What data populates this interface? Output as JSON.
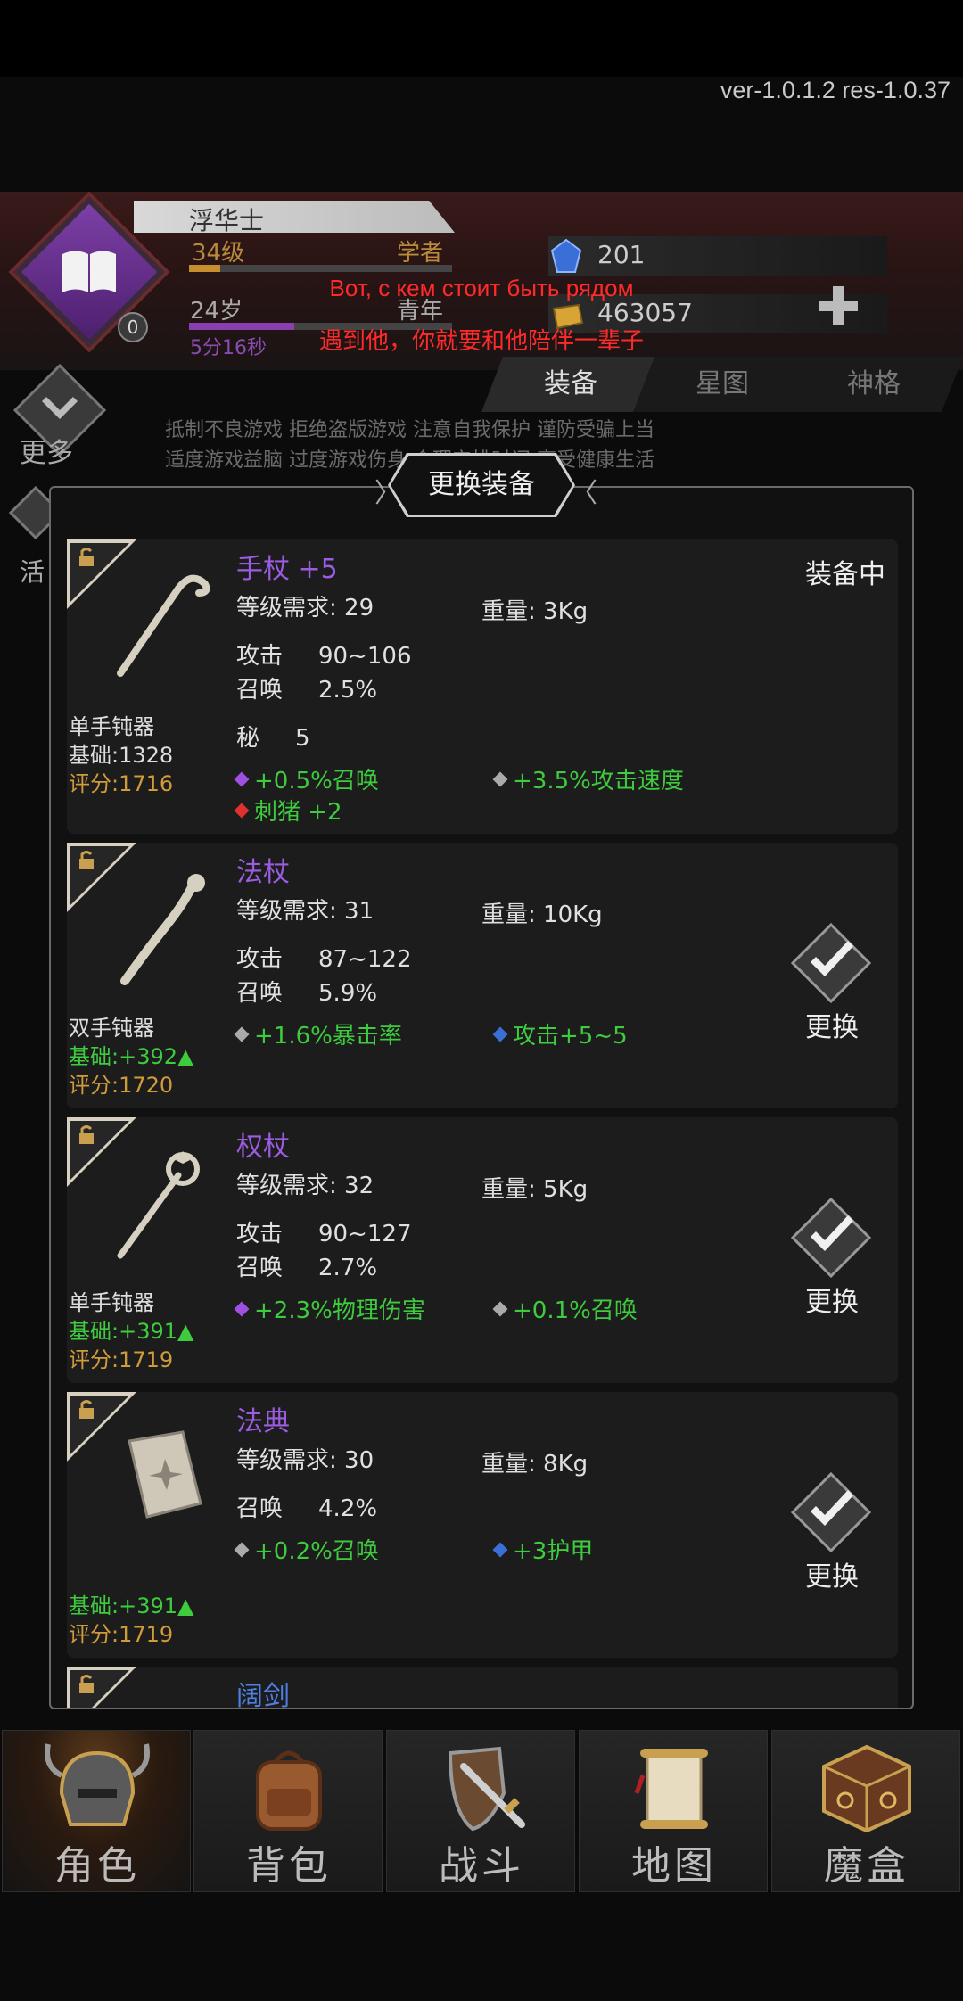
{
  "version": "ver-1.0.1.2  res-1.0.37",
  "player": {
    "name": "浮华士",
    "level": "34级",
    "class": "学者",
    "age": "24岁",
    "stage": "青年",
    "time": "5分16秒",
    "badge": "0"
  },
  "resources": {
    "gems": "201",
    "gold": "463057"
  },
  "subtitles": {
    "line1": "Вот, с кем стоит быть рядом",
    "line2": "遇到他，你就要和他陪伴一辈子"
  },
  "tabs": [
    "装备",
    "星图",
    "神格"
  ],
  "left_menu": {
    "more": "更多",
    "activity": "活"
  },
  "notice": {
    "line1": "抵制不良游戏 拒绝盗版游戏 注意自我保护 谨防受骗上当",
    "line2": "适度游戏益脑 过度游戏伤身 合理安排时间 享受健康生活"
  },
  "dialog": {
    "title": "更换装备",
    "labels": {
      "req": "等级需求:",
      "weight": "重量:",
      "attack": "攻击",
      "summon": "召唤",
      "secret": "秘"
    },
    "items": [
      {
        "name": "手杖 +5",
        "req": "29",
        "weight": "3Kg",
        "attack": "90~106",
        "summon": "2.5%",
        "secret": "5",
        "type": "单手钝器",
        "base": "基础:1328",
        "score": "评分:1716",
        "status": "装备中",
        "affixes": [
          "+0.5%召唤",
          "+3.5%攻击速度",
          "刺猪 +2"
        ]
      },
      {
        "name": "法杖",
        "req": "31",
        "weight": "10Kg",
        "attack": "87~122",
        "summon": "5.9%",
        "type": "双手钝器",
        "base": "基础:+392",
        "score": "评分:1720",
        "action": "更换",
        "affixes": [
          "+1.6%暴击率",
          "攻击+5~5"
        ]
      },
      {
        "name": "权杖",
        "req": "32",
        "weight": "5Kg",
        "attack": "90~127",
        "summon": "2.7%",
        "type": "单手钝器",
        "base": "基础:+391",
        "score": "评分:1719",
        "action": "更换",
        "affixes": [
          "+2.3%物理伤害",
          "+0.1%召唤"
        ]
      },
      {
        "name": "法典",
        "req": "30",
        "weight": "8Kg",
        "summon": "4.2%",
        "base": "基础:+391",
        "score": "评分:1719",
        "action": "更换",
        "affixes": [
          "+0.2%召唤",
          "+3护甲"
        ]
      },
      {
        "name": "阔剑"
      }
    ]
  },
  "nav": [
    "角色",
    "背包",
    "战斗",
    "地图",
    "魔盒"
  ],
  "colors": {
    "purple_name": "#9b5ce0",
    "blue_name": "#4f7fe0",
    "affix_green": "#3ecb3e",
    "score_gold": "#d29b3a",
    "subtitle_red": "#ff2a2a"
  }
}
